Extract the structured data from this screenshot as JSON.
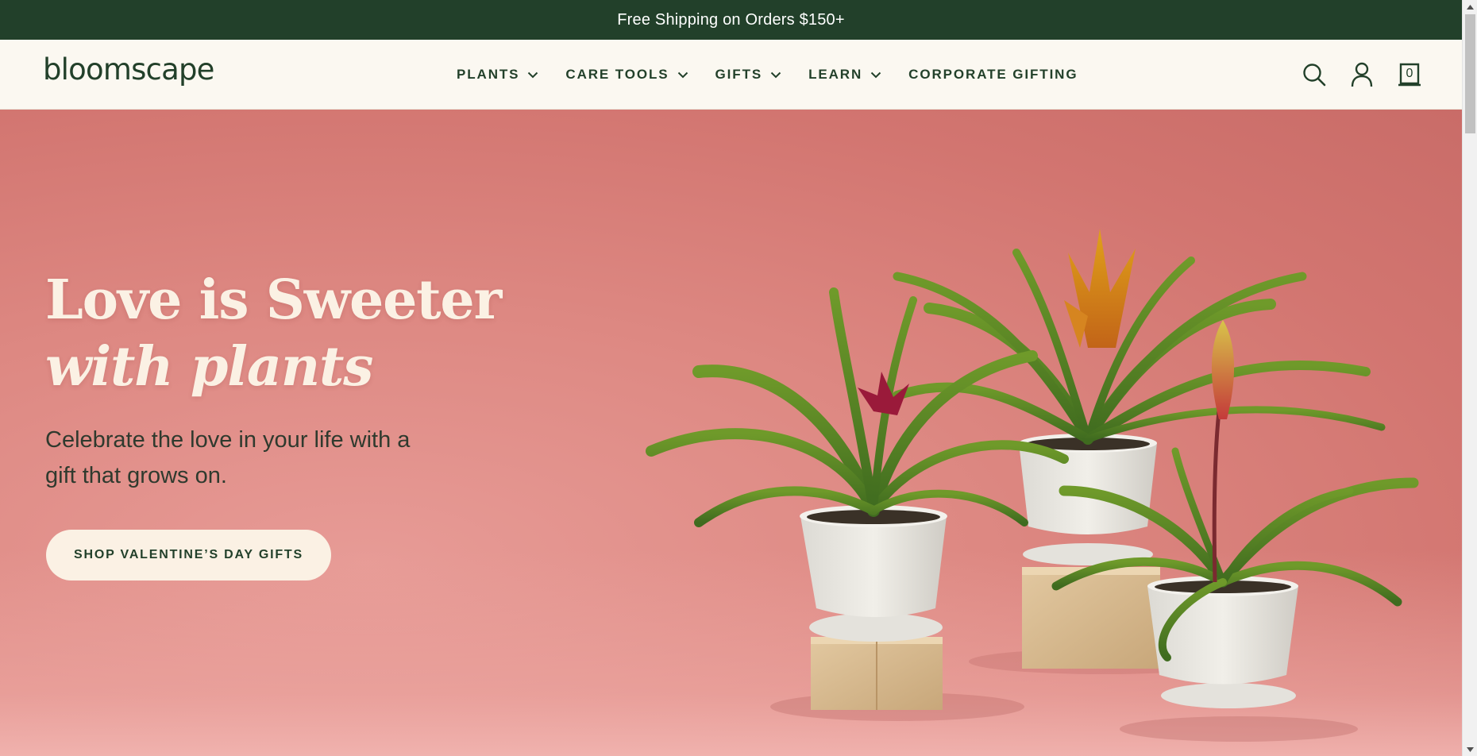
{
  "announcement": {
    "text": "Free Shipping on Orders $150+"
  },
  "header": {
    "logo": "bloomscape",
    "nav": [
      {
        "label": "PLANTS",
        "has_dropdown": true
      },
      {
        "label": "CARE TOOLS",
        "has_dropdown": true
      },
      {
        "label": "GIFTS",
        "has_dropdown": true
      },
      {
        "label": "LEARN",
        "has_dropdown": true
      },
      {
        "label": "CORPORATE GIFTING",
        "has_dropdown": false
      }
    ],
    "icons": [
      "search-icon",
      "account-icon",
      "cart-icon"
    ],
    "cart_count": "0"
  },
  "hero": {
    "title_line1": "Love is Sweeter",
    "title_line2": "with plants",
    "subtitle": "Celebrate the love in your life with a gift that grows on.",
    "cta_label": "SHOP VALENTINE’S DAY GIFTS"
  },
  "colors": {
    "brand_green": "#22402a",
    "cream": "#fbf8f1",
    "hero_pink": "#dd8882"
  }
}
